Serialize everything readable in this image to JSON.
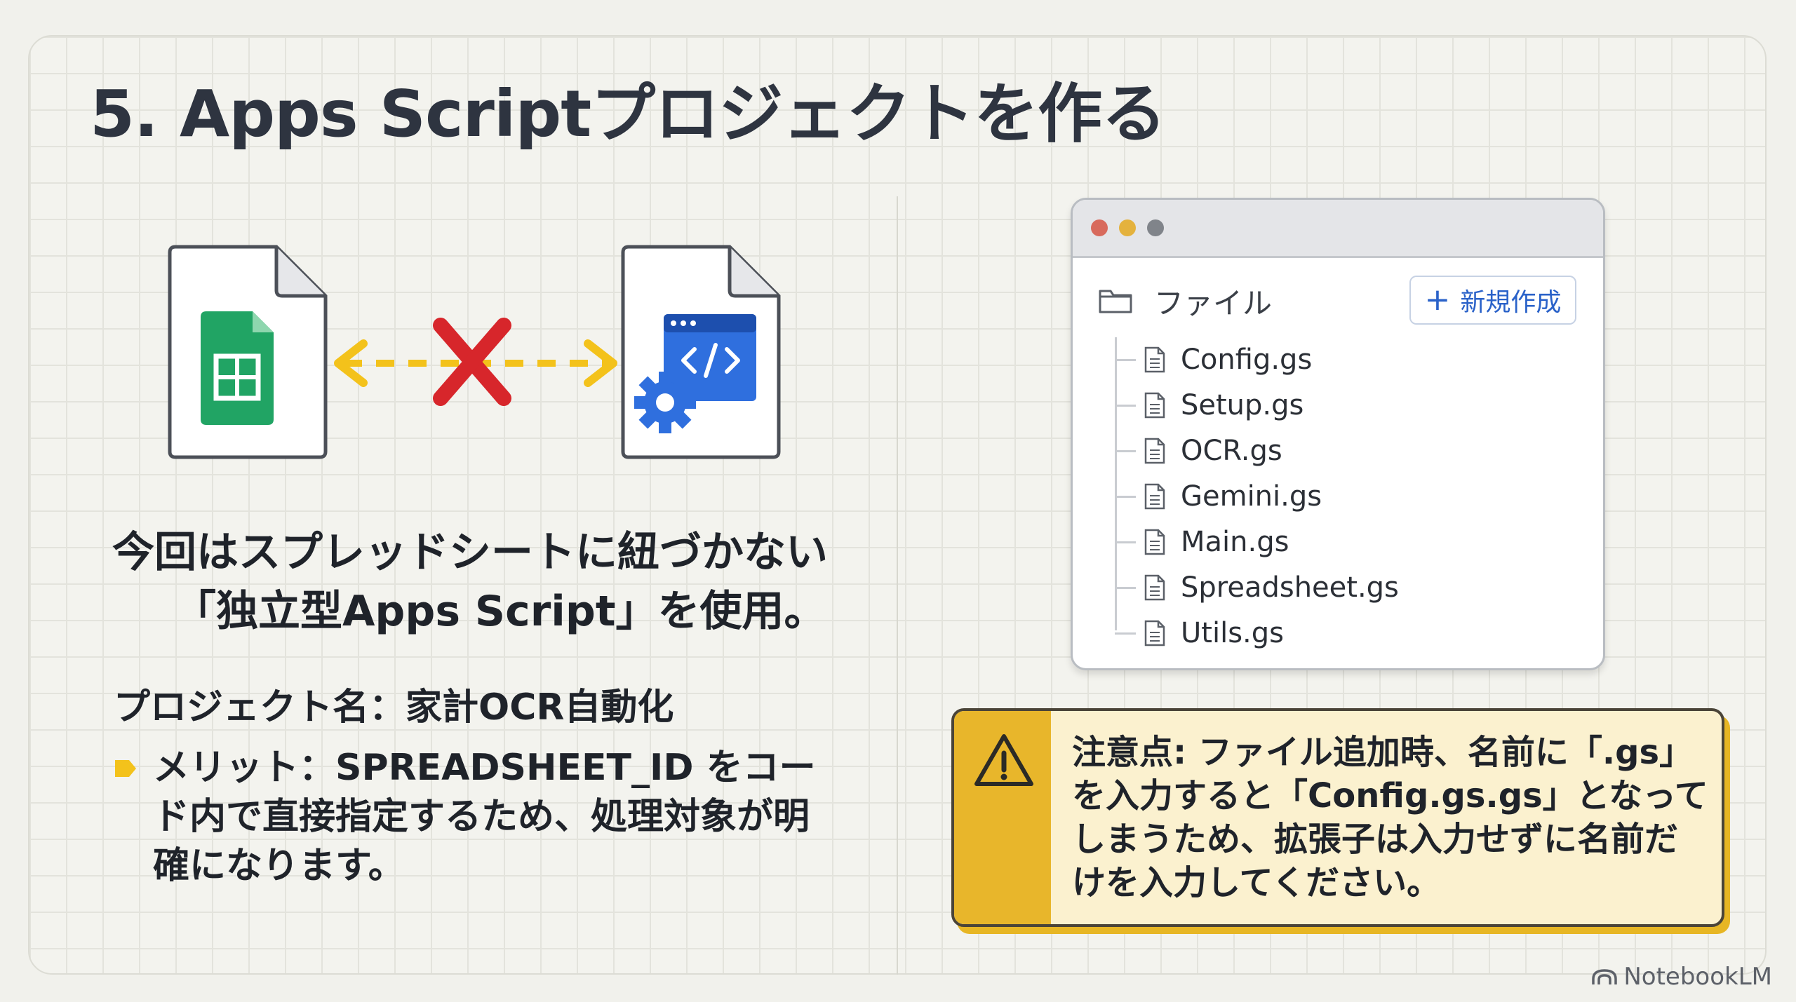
{
  "slide": {
    "title": "5. Apps Scriptプロジェクトを作る"
  },
  "illustration": {
    "left_icon": "google-sheets-file-icon",
    "right_icon": "apps-script-file-icon",
    "connector_icon": "red-x-icon",
    "colors": {
      "arrow": "#f3c21b",
      "cross": "#d7262b",
      "sheets": "#21a464",
      "script": "#2f6fde"
    }
  },
  "lead": {
    "line1": "今回はスプレッドシートに紐づかない",
    "line2": "「独立型Apps Script」を使用。"
  },
  "project": {
    "text": "プロジェクト名：家計OCR自動化"
  },
  "merit": {
    "text": "メリット：SPREADSHEET_ID をコード内で直接指定するため、処理対象が明確になります。"
  },
  "window": {
    "folder_label": "ファイル",
    "new_button": "新規作成",
    "files": [
      "Config.gs",
      "Setup.gs",
      "OCR.gs",
      "Gemini.gs",
      "Main.gs",
      "Spreadsheet.gs",
      "Utils.gs"
    ]
  },
  "warning": {
    "line1": "注意点: ファイル追加時、名前に「.gs」",
    "line2": "を入力すると「Config.gs.gs」となって",
    "line3": "しまうため、拡張子は入力せずに名前だ",
    "line4": "けを入力してください。"
  },
  "brand": {
    "name": "NotebookLM"
  }
}
